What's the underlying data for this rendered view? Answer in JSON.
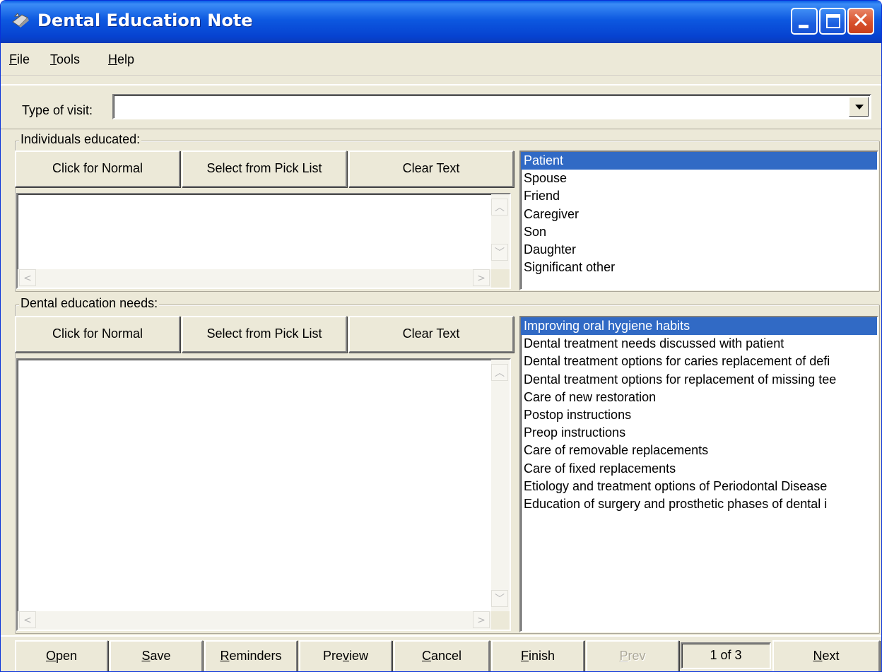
{
  "window": {
    "title": "Dental Education Note",
    "accent_color": "#0a5fe8",
    "close_color": "#d8512c"
  },
  "menu": [
    {
      "label": "File",
      "mnemonic": "F",
      "rest": "ile"
    },
    {
      "label": "Tools",
      "mnemonic": "T",
      "rest": "ools"
    },
    {
      "label": "Help",
      "mnemonic": "H",
      "rest": "elp"
    }
  ],
  "visit": {
    "label": "Type of visit:",
    "value": ""
  },
  "individuals": {
    "group_label": "Individuals educated:",
    "buttons": {
      "normal": "Click for Normal",
      "pick": "Select from Pick List",
      "clear": "Clear Text"
    },
    "text": "",
    "list": [
      "Patient",
      "Spouse",
      "Friend",
      "Caregiver",
      "Son",
      "Daughter",
      "Significant other"
    ],
    "selected": "Patient"
  },
  "needs": {
    "group_label": "Dental education needs:",
    "buttons": {
      "normal": "Click for Normal",
      "pick": "Select from Pick List",
      "clear": "Clear Text"
    },
    "text": "",
    "list": [
      "Improving oral hygiene habits",
      "Dental treatment needs discussed with patient",
      "Dental treatment options for caries replacement of defi",
      "Dental treatment options for replacement of missing tee",
      "Care of new restoration",
      "Postop instructions",
      "Preop instructions",
      "Care of removable replacements",
      "Care of fixed replacements",
      "Etiology and treatment options of Periodontal Disease",
      "Education of surgery and prosthetic phases of dental i"
    ],
    "selected": "Improving oral hygiene habits",
    "selected_color": "#316ac5"
  },
  "bottom": {
    "open": {
      "mnemonic": "O",
      "rest": "pen"
    },
    "save": {
      "mnemonic": "S",
      "rest": "ave"
    },
    "reminders": {
      "mnemonic": "R",
      "rest": "eminders"
    },
    "preview": {
      "pre": "Pre",
      "mnemonic": "v",
      "rest": "iew"
    },
    "cancel": {
      "mnemonic": "C",
      "rest": "ancel"
    },
    "finish": {
      "mnemonic": "F",
      "rest": "inish"
    },
    "prev": {
      "mnemonic": "P",
      "rest": "rev"
    },
    "page": "1 of 3",
    "next": {
      "mnemonic": "N",
      "rest": "ext"
    }
  }
}
